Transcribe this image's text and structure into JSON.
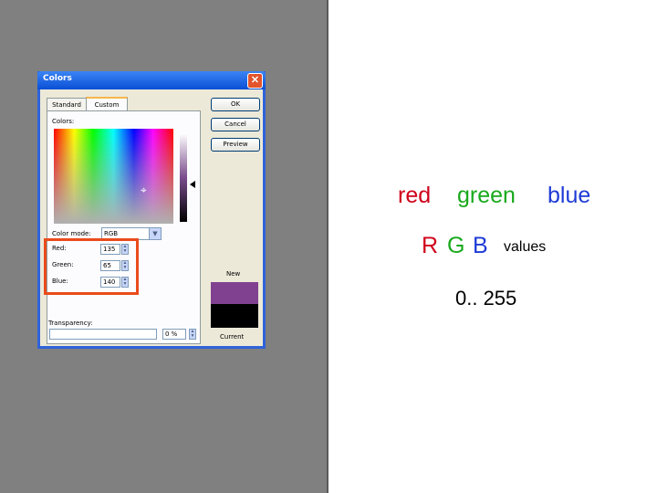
{
  "dialog": {
    "title": "Colors",
    "close_glyph": "✕",
    "tabs": [
      {
        "label": "Standard",
        "active": false
      },
      {
        "label": "Custom",
        "active": true
      }
    ],
    "colors_label": "Colors:",
    "color_mode_label": "Color mode:",
    "color_mode_value": "RGB",
    "fields": [
      {
        "label": "Red:",
        "value": "135"
      },
      {
        "label": "Green:",
        "value": "65"
      },
      {
        "label": "Blue:",
        "value": "140"
      }
    ],
    "buttons": {
      "ok": "OK",
      "cancel": "Cancel",
      "preview": "Preview"
    },
    "new_label": "New",
    "current_label": "Current",
    "transparency_label": "Transparency:",
    "transparency_value": "0 %",
    "new_color": "#7f4190",
    "current_color": "#000000"
  },
  "annotations": {
    "colors_line": {
      "red": "red",
      "green": "green",
      "blue": "blue"
    },
    "rgb_line": {
      "r": "R",
      "g": "G",
      "b": "B",
      "suffix": "values"
    },
    "range": "0.. 255"
  },
  "colors": {
    "red": "#d0021b",
    "green": "#18a91c",
    "blue": "#1f3bd6",
    "highlight": "#ea4b1c"
  }
}
